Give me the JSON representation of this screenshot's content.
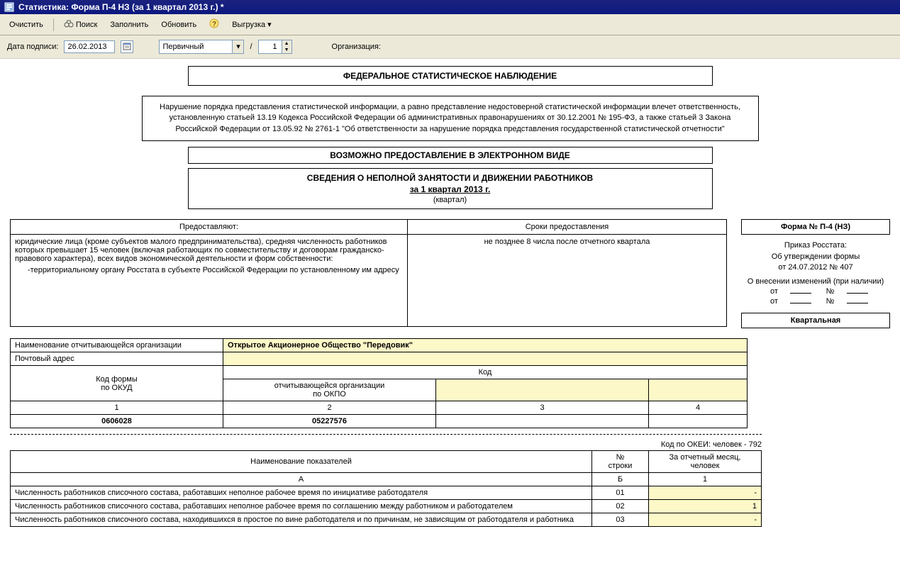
{
  "window_title": "Статистика: Форма П-4 НЗ (за 1 квартал 2013 г.) *",
  "toolbar": {
    "clear": "Очистить",
    "search": "Поиск",
    "fill": "Заполнить",
    "refresh": "Обновить",
    "export": "Выгрузка"
  },
  "params": {
    "date_label": "Дата подписи:",
    "date_value": "26.02.2013",
    "type_value": "Первичный",
    "slash": "/",
    "num_value": "1",
    "org_label": "Организация:"
  },
  "header": {
    "h1": "ФЕДЕРАЛЬНОЕ СТАТИСТИЧЕСКОЕ НАБЛЮДЕНИЕ",
    "warn": "Нарушение порядка представления статистической информации, а равно представление недостоверной статистической информации влечет ответственность, установленную статьей 13.19 Кодекса Российской Федерации об административных правонарушениях от 30.12.2001 № 195-ФЗ, а также статьей 3 Закона Российской Федерации от 13.05.92 № 2761-1 \"Об ответственности за нарушение порядка представления государственной статистической отчетности\"",
    "h2": "ВОЗМОЖНО ПРЕДОСТАВЛЕНИЕ В ЭЛЕКТРОННОМ ВИДЕ",
    "t1": "СВЕДЕНИЯ О НЕПОЛНОЙ ЗАНЯТОСТИ И ДВИЖЕНИИ РАБОТНИКОВ",
    "t2": "за 1 квартал 2013 г.",
    "t3": "(квартал)"
  },
  "provides": {
    "col1": "Предоставляют:",
    "col2": "Сроки предоставления",
    "body1": "юридические лица (кроме субъектов малого предпринимательства), средняя численность работников которых превышает 15 человек (включая работающих по совместительству и договорам гражданско-правового характера), всех видов экономической деятельности и форм собственности:",
    "body1b": "-территориальному органу Росстата в субъекте Российской Федерации по установленному им адресу",
    "body2": "не позднее 8 числа после отчетного квартала"
  },
  "rightcol": {
    "form_no": "Форма № П-4 (НЗ)",
    "order1": "Приказ Росстата:",
    "order2": "Об утверждении формы",
    "order3": "от 24.07.2012 № 407",
    "changes": "О внесении изменений (при наличии)",
    "from": "от",
    "no": "№",
    "periodicity": "Квартальная"
  },
  "org": {
    "r1_label": "Наименование отчитывающейся организации",
    "r1_val": "Открытое Акционерное Общество \"Передовик\"",
    "r2_label": "Почтовый адрес",
    "code_form": "Код формы\nпо ОКУД",
    "code_header": "Код",
    "okpo": "отчитывающейся организации\nпо ОКПО",
    "c1": "1",
    "c2": "2",
    "c3": "3",
    "c4": "4",
    "v1": "0606028",
    "v2": "05227576"
  },
  "okei": "Код по ОКЕИ: человек - 792",
  "data_table": {
    "h1": "Наименование показателей",
    "h2": "№\nстроки",
    "h3": "За отчетный месяц,\nчеловек",
    "sa": "А",
    "sb": "Б",
    "s1": "1",
    "rows": [
      {
        "name": "Численность работников списочного состава, работавших неполное рабочее время по инициативе работодателя",
        "no": "01",
        "val": "-"
      },
      {
        "name": "Численность работников списочного состава, работавших неполное рабочее время по соглашению между работником и работодателем",
        "no": "02",
        "val": "1"
      },
      {
        "name": "Численность работников списочного состава, находившихся в простое по вине работодателя и по причинам, не зависящим от работодателя и работника",
        "no": "03",
        "val": "-"
      }
    ]
  }
}
